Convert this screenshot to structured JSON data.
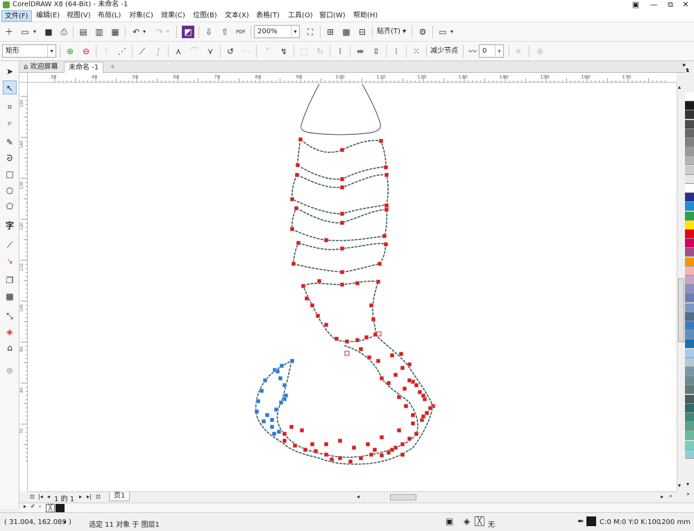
{
  "app": {
    "title": "CorelDRAW X8 (64-Bit) - 未命名 -1"
  },
  "window_buttons": {
    "minimize": "—",
    "restore": "⧉",
    "close": "✕"
  },
  "menu": [
    "文件(F)",
    "编辑(E)",
    "视图(V)",
    "布局(L)",
    "对象(C)",
    "效果(C)",
    "位图(B)",
    "文本(X)",
    "表格(T)",
    "工具(O)",
    "窗口(W)",
    "帮助(H)"
  ],
  "toolbar": {
    "zoom_value": "200%",
    "snap_label": "贴齐(T)",
    "pdf_label": "PDF"
  },
  "propertybar": {
    "shape_select": "矩形",
    "reduce_nodes_label": "减少节点",
    "smooth_value": "0"
  },
  "doc_tabs": {
    "welcome": "欢迎屏幕",
    "current": "未命名 -1"
  },
  "ruler": {
    "h_labels": [
      "30",
      "40",
      "50",
      "60",
      "70",
      "80",
      "90",
      "100",
      "110",
      "120",
      "130",
      "140",
      "150",
      "160",
      "170"
    ],
    "v_labels": [
      "150",
      "140",
      "130",
      "120",
      "110",
      "100",
      "90",
      "80",
      "70"
    ]
  },
  "page_nav": {
    "current": "1",
    "of": "的",
    "total": "1",
    "page_tab": "页1"
  },
  "status": {
    "coords": "( 31.004, 162.089 )",
    "selection": "选定 11 对象 于 图层1",
    "fill_none": "无",
    "color_info": "C:0 M:0 Y:0 K:100",
    "outline_width": ".200 mm"
  },
  "palette_colors": [
    "#ffffff",
    "#1a1a1a",
    "#333333",
    "#4d4d4d",
    "#666666",
    "#808080",
    "#999999",
    "#b3b3b3",
    "#cccccc",
    "#e6e6e6",
    "#ffffff",
    "#2b2e8f",
    "#1b8fd6",
    "#2aa14a",
    "#ffe600",
    "#e60012",
    "#d6005e",
    "#a0518a",
    "#f39800",
    "#f5b2b2",
    "#c8a2c8",
    "#8f8fbf",
    "#6b7fb4",
    "#7c95c8",
    "#4f6d8f",
    "#3a7bbf",
    "#5c8fbf",
    "#1f6fb0",
    "#a5c9e8",
    "#b4c8d8",
    "#7a96a8",
    "#6f8a8f",
    "#5d7a7a",
    "#4b5d63",
    "#2f6b6b",
    "#3f8a7a",
    "#5aa08a",
    "#6ab8a0",
    "#7ccfc0",
    "#8fd0d8"
  ]
}
